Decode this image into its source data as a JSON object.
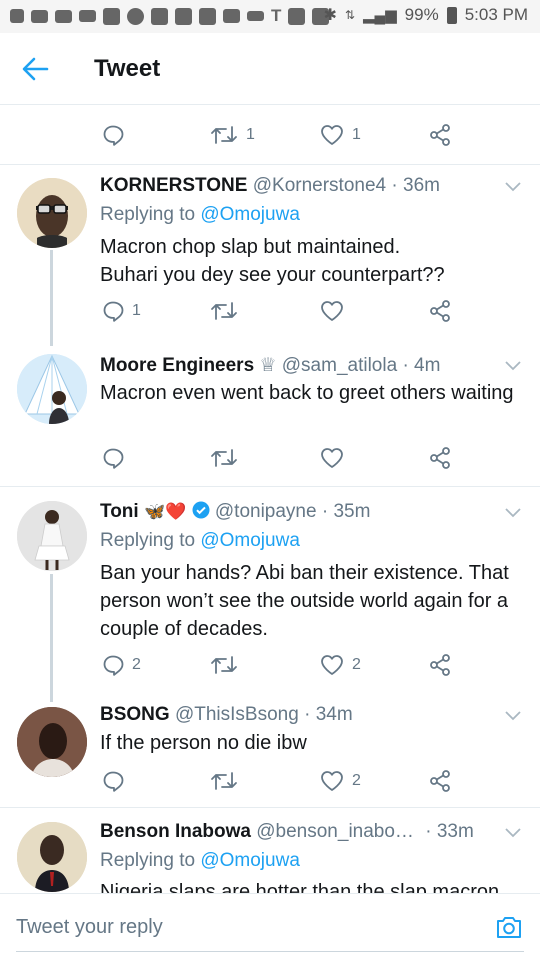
{
  "status_bar": {
    "battery": "99%",
    "time": "5:03 PM"
  },
  "header": {
    "title": "Tweet",
    "back_icon": "arrow-left-icon"
  },
  "top_actions": {
    "retweets": "1",
    "likes": "1"
  },
  "tweets": [
    {
      "name": "KORNERSTONE",
      "handle": "@Kornerstone4",
      "time": "· 36m",
      "replying_prefix": "Replying to ",
      "replying_to": "@Omojuwa",
      "text": "Macron chop slap but maintained.\nBuhari you dey see your counterpart??",
      "replies": "1",
      "retweets": "",
      "likes": ""
    },
    {
      "name": "Moore Engineers",
      "badge": "♕",
      "handle": "@sam_atilola",
      "time": "· 4m",
      "text": "Macron even went back to greet others waiting",
      "replies": "",
      "retweets": "",
      "likes": ""
    },
    {
      "name": "Toni",
      "emoji": "🦋❤️",
      "handle": "@tonipayne",
      "time": "· 35m",
      "replying_prefix": "Replying to ",
      "replying_to": "@Omojuwa",
      "text": "Ban your hands? Abi ban their existence. That person won’t see the outside world again for a couple of decades.",
      "replies": "2",
      "retweets": "",
      "likes": "2"
    },
    {
      "name": "BSONG",
      "handle": "@ThisIsBsong",
      "time": "· 34m",
      "text": "If the person no die ibw",
      "replies": "",
      "retweets": "",
      "likes": "2"
    },
    {
      "name": "Benson Inabowa",
      "handle": "@benson_inabo…",
      "time": "· 33m",
      "replying_prefix": "Replying to ",
      "replying_to": "@Omojuwa",
      "text": "Nigeria slaps are hotter than the slap macron"
    }
  ],
  "reply_bar": {
    "placeholder": "Tweet your reply",
    "camera_icon": "camera-icon"
  },
  "colors": {
    "accent": "#1da1f2",
    "muted": "#657786",
    "text": "#14171a",
    "border": "#e6ecf0"
  }
}
